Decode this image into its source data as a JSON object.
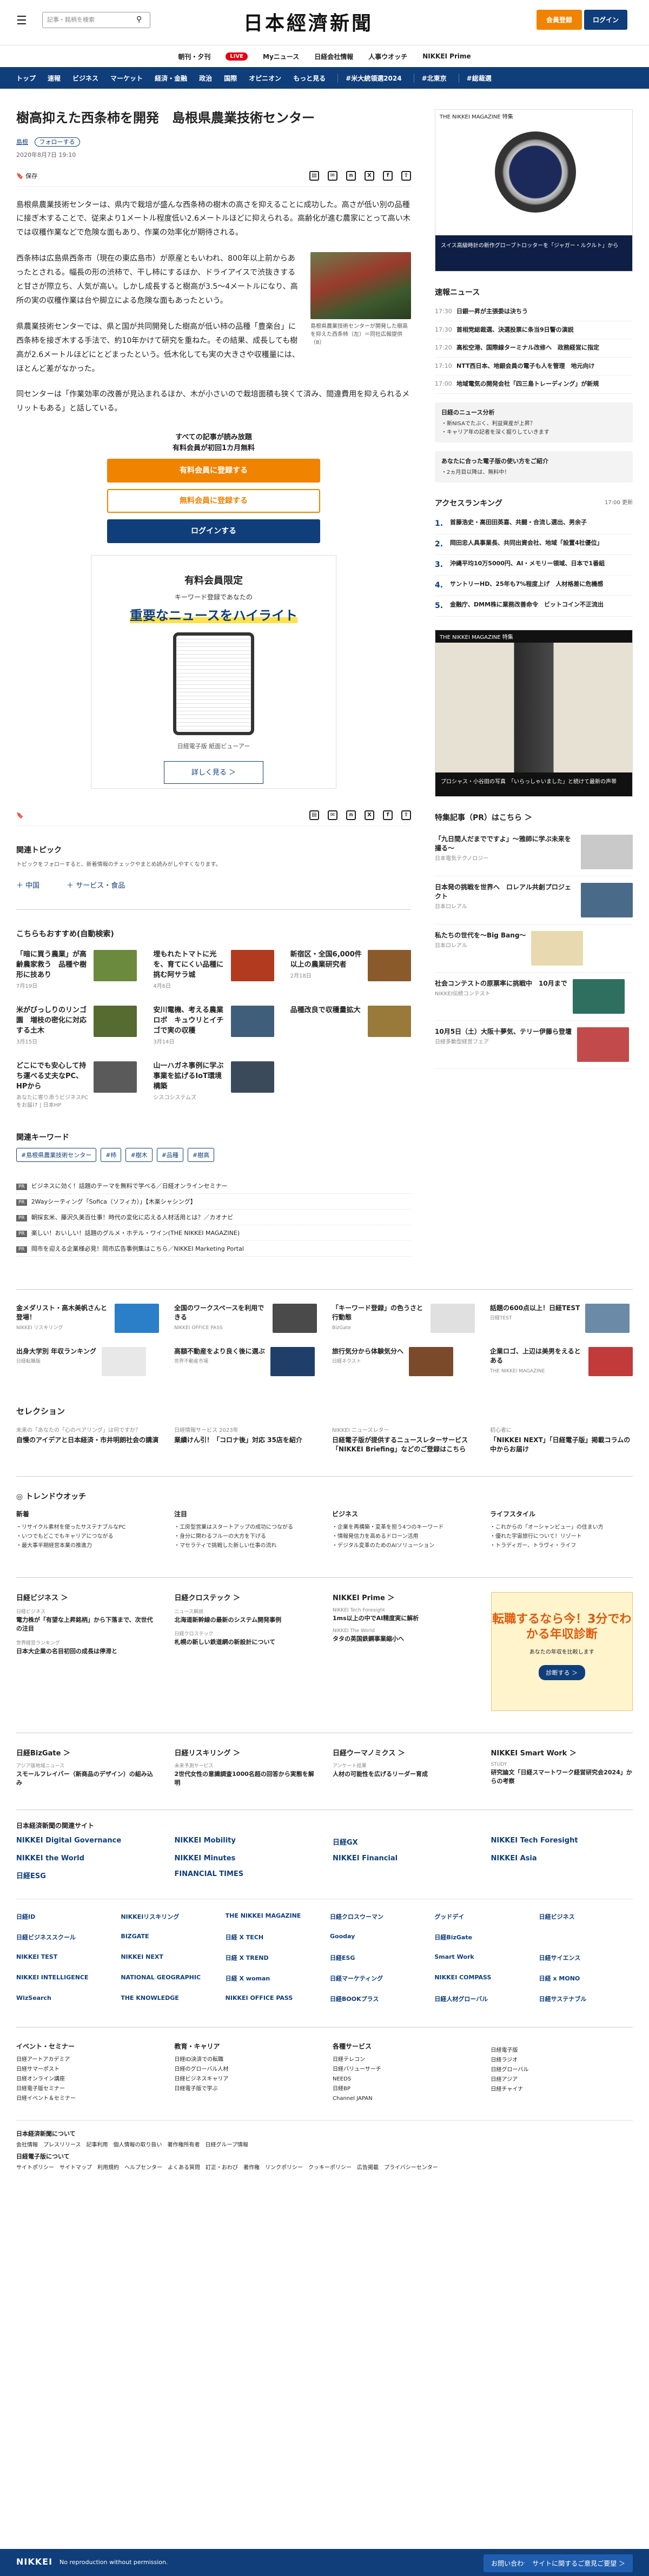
{
  "header": {
    "search_placeholder": "記事・銘柄を検索",
    "logo": "日本經濟新聞",
    "member_button": "会員登録",
    "login_button": "ログイン"
  },
  "subnav": [
    "朝刊・夕刊",
    "LIVE",
    "Myニュース",
    "日経会社情報",
    "人事ウオッチ",
    "NIKKEI Prime"
  ],
  "gnav": [
    "トップ",
    "速報",
    "ビジネス",
    "マーケット",
    "経済・金融",
    "政治",
    "国際",
    "オピニオン",
    "もっと見る",
    "#米大統領選2024",
    "#北東京",
    "#総裁選"
  ],
  "article": {
    "title": "樹高抑えた西条柿を開発　島根県農業技術センター",
    "tag": "島根",
    "follow": "フォローする",
    "date": "2020年8月7日 19:10",
    "save": "保存",
    "p1": "島根県農業技術センターは、県内で栽培が盛んな西条柿の樹木の高さを抑えることに成功した。高さが低い別の品種に接ぎ木することで、従来より1メートル程度低い2.6メートルほどに抑えられる。高齢化が進む農家にとって高い木では収穫作業などで危険な面もあり、作業の効率化が期待される。",
    "p2": "西条柿は広島県西条市（現在の東広島市）が原産ともいわれ、800年以上前からあったとされる。幅長の形の渋柿で、干し柿にするほか、ドライアイスで渋抜きすると甘さが際立ち、人気が高い。しかし成長すると樹高が3.5〜4メートルになり、高所の実の収穫作業は台や脚立による危険な面もあったという。",
    "p3": "県農業技術センターでは、県と国が共同開発した樹高が低い柿の品種「豊楽台」に西条柿を接ぎ木する手法で、約10年かけて研究を重ねた。その結果、成長しても樹高が2.6メートルほどにとどまったという。低木化しても実の大きさや収穫量には、ほとんど差がなかった。",
    "p4": "同センターは「作業効率の改善が見込まれるほか、木が小さいので栽培面積も狭くて済み、間違費用を抑えられるメリットもある」と話している。",
    "figcap": "島根県農業技術センターが開発した樹高を抑えた西条柿（左）＝同社広報提供（8）"
  },
  "paywall": {
    "lead1": "すべての記事が読み放題",
    "lead2": "有料会員が初回1カ月無料",
    "btn_register": "有料会員に登録する",
    "btn_free": "無料会員に登録する",
    "btn_login": "ログインする"
  },
  "promo": {
    "t1": "有料会員限定",
    "t2": "キーワード登録であなたの",
    "t3a": "重要なニュースを",
    "t3b": "ハイライト",
    "cap": "日経電子版 紙面ビューアー",
    "more": "詳しく見る ＞"
  },
  "topics": {
    "heading": "関連トピック",
    "sub": "トピックをフォローすると、新着情報のチェックやまとめ読みがしやすくなります。",
    "items": [
      "＋ 中国",
      "＋ サービス・食品"
    ]
  },
  "reco": {
    "heading": "こちらもおすすめ(自動検索)",
    "items": [
      {
        "title": "「暗に買う農業」が高齢農家救う　品種や樹形に技あり",
        "sub": "7月19日",
        "color": "#6c8a3e"
      },
      {
        "title": "埋もれたトマトに光を、育てにくい品種に挑む阿サラ城",
        "sub": "4月6日",
        "color": "#b23a1e"
      },
      {
        "title": "新宿区・全国6,000件以上の農業研究者",
        "sub": "2月18日",
        "color": "#8a5a2a"
      },
      {
        "title": "米がびっしりのリンゴ園　増枝の密化に対応する土木",
        "sub": "3月15日",
        "color": "#556b2f"
      },
      {
        "title": "安川電機、考える農業ロボ　キュウリとイチゴで実の収穫",
        "sub": "3月14日",
        "color": "#3f5e7a"
      },
      {
        "title": "品種改良で収穫量拡大",
        "sub": "",
        "color": "#9a7a3a"
      },
      {
        "title": "どこにでも安心して持ち運べる丈夫なPC、HPから",
        "sub": "あなたに寄り添うビジネスPCをお届け | 日本HP",
        "color": "#5a5a5a"
      },
      {
        "title": "山一ハガネ事例に学ぶ事業を拡げるIoT環境構築",
        "sub": "シスコシステムズ",
        "color": "#3a4a5a"
      },
      {
        "title": "",
        "sub": "",
        "color": "#ffffff"
      }
    ]
  },
  "keywords": {
    "heading": "関連キーワード",
    "items": [
      "#島根県農業技術センター",
      "#柿",
      "#樹木",
      "#品種",
      "#樹高"
    ]
  },
  "pr_list": [
    "ビジネスに効く！話題のテーマを無料で学べる／日経オンラインセミナー",
    "2Wayシーティング「Sofica（ソフィカ）」【木楽シャシング】",
    "朝採玄米、藤沢久美百仕事！時代の変化に応える人材活用とは？／カオナビ",
    "楽しい！おいしい！話題のグルメ・ホテル・ワイン(THE NIKKEI MAGAZINE)",
    "岡市を迎える企業様必見！岡市広告事例集はこちら／NIKKEI Marketing Portal"
  ],
  "side": {
    "mag_label": "THE NIKKEI MAGAZINE 特集",
    "mag_band": "スイス高級時計の新作グローブトロッターを「ジャガー・ルクルト」から",
    "breaking_heading": "速報ニュース",
    "breaking": [
      {
        "time": "17:30",
        "text": "日銀一昇が主張委は決ちう"
      },
      {
        "time": "17:30",
        "text": "首相党総裁選、決選投票に条当9日警の演説"
      },
      {
        "time": "17:20",
        "text": "高松空港、国際線ターミナル改修へ　政務経営に指定"
      },
      {
        "time": "17:10",
        "text": "NTT西日本、地銀会員の電子も人を管理　地元向け"
      },
      {
        "time": "17:00",
        "text": "地域電気の開発会社「四三島トレーディング」が新規"
      }
    ],
    "nikkei_box_title": "日経のニュース分析",
    "nikkei_box_items": [
      "・新NISAでたぶく、利益資産が上昇？",
      "・キャリア年の記者を深く掘りしていきます"
    ],
    "nikkei_box2_title": "あなたに合った電子版の使い方をご紹介",
    "nikkei_box2_items": [
      "・2ヵ月目以降は、無料中！"
    ],
    "ranking_heading": "アクセスランキング",
    "ranking_time": "17:00 更新",
    "ranking": [
      "首藤浩史・高田田英喜、共闘・合流し選出、男余子",
      "岡田忠人具事業長、共同出資会社、地域「設置4社優位」",
      "沖縄平均10万5000円、AI・メモリー領域、日本で1番組",
      "サントリーHD、25年も7%程度上げ　人材格差に危機感",
      "金融庁、DMM株に業務改善命令　ビットコイン不正流出"
    ],
    "photo_label": "THE NIKKEI MAGAZINE 特集",
    "photo_band": "プロシャス・小谷田の写真　「いらっしゃいました」と続けて最新の声帯",
    "pr_heading": "特集記事（PR）はこちら ＞",
    "pr_items": [
      {
        "title": "「九日間人だまでですよ」〜雅師に学ぶ未来を撮る〜",
        "sub": "日本電気テクノロジー",
        "color": "#c9c9c9"
      },
      {
        "title": "日本発の挑戦を世界へ　ロレアル共創プロジェクト",
        "sub": "日本ロレアル",
        "color": "#4a6a8a"
      },
      {
        "title": "私たちの世代を〜Big Bang〜",
        "sub": "日本ロレアル",
        "color": "#e8d9b0"
      },
      {
        "title": "社会コンテストの原票率に挑戦中　10月まで",
        "sub": "NIKKEI伝統コンテスト",
        "color": "#2f6f5f"
      },
      {
        "title": "10月5日（土）大阪十夢気、テリー伊藤ら登壇",
        "sub": "日経多動型経営フェア",
        "color": "#c24a4a"
      }
    ]
  },
  "ads": [
    {
      "title": "金メダリスト・高木美帆さんと登場！",
      "sub": "NIKKEI リスキリング",
      "color": "#2b7fc8"
    },
    {
      "title": "全国のワークスペースを利用できる",
      "sub": "NIKKEI OFFICE PASS",
      "color": "#4a4a4a"
    },
    {
      "title": "「キーワード登録」の色うさと行動態",
      "sub": "BizGate",
      "color": "#e0e0e0"
    },
    {
      "title": "話題の600点以上！日経TEST",
      "sub": "日経TEST",
      "color": "#6a8aa8"
    },
    {
      "title": "出身大学別 年収ランキング",
      "sub": "日経転職版",
      "color": "#e8e8e8"
    },
    {
      "title": "高額不動産をより良く後に選ぶ",
      "sub": "世界不動産市場",
      "color": "#1f3f6a"
    },
    {
      "title": "旅行気分から体験気分へ",
      "sub": "日経ネクスト",
      "color": "#7a4a2a"
    },
    {
      "title": "企業ロゴ、上辺は美男をえるとある",
      "sub": "THE NIKKEI MAGAZINE",
      "color": "#c23a3a"
    }
  ],
  "selection": {
    "heading": "セレクション",
    "items": [
      {
        "k": "未来の「あなたの「心のペアリング」は何ですか？",
        "v": "自慢のアイデアと日本経済・市井明朗社会の講演"
      },
      {
        "k": "日経情報サービス 2023年",
        "v": "業績けん引！「コロナ後」対応 35店を紹介"
      },
      {
        "k": "NIKKEI ニュースレター",
        "v": "日経電子版が提供するニュースレターサービス「NIKKEI Briefing」などのご登録はこちら"
      },
      {
        "k": "初心者に",
        "v": "「NIKKEI NEXT」「日経電子版」掲載コラムの中からお届け"
      }
    ]
  },
  "trend": {
    "heading": "トレンドウオッチ",
    "cols": [
      {
        "k": "新着",
        "items": [
          "・リサイクル素材を使ったサステナブルなPC",
          "・いつでもどこでもキャリアにつながる",
          "・最大事半期経営本業の推進力"
        ]
      },
      {
        "k": "注目",
        "items": [
          "・工房型営業はスタートアップの成功につながる",
          "・身分に関わるフルーの大方を下げる",
          "・マセラティで挑戦した新しい仕事の流れ"
        ]
      },
      {
        "k": "ビジネス",
        "items": [
          "・企業を再構築・変革を担う4つのキーワード",
          "・情報発信力を高めるドローン活用",
          "・デジタル変革のためのAIソリューション"
        ]
      },
      {
        "k": "ライフスタイル",
        "items": [
          "・これからの「オーシャンビュー」の住まい方",
          "・優れた宇宙旅行について！リゾート",
          "・トラディガー、トラヴィ・ライフ"
        ]
      }
    ]
  },
  "services": [
    {
      "k": "日経ビジネス ＞",
      "items": [
        {
          "s": "日経ビジネス",
          "v": "電力株が「有望な上昇銘柄」から下落まで、次世代の注目"
        },
        {
          "s": "世界経営ランキング",
          "v": "日本大企業の名目初回の成長は停滞と"
        }
      ]
    },
    {
      "k": "日経クロステック ＞",
      "items": [
        {
          "s": "ニュース解説",
          "v": "北海道新幹線の最新のシステム開発事例"
        },
        {
          "s": "日経クロステック",
          "v": "札幌の新しい鉄道網の新設計について"
        }
      ]
    },
    {
      "k": "NIKKEI Prime ＞",
      "items": [
        {
          "s": "NIKKEI Tech Foresight",
          "v": "1ms以上の中でAI精度実に解析"
        },
        {
          "s": "NIKKEI The World",
          "v": "タタの英国鉄鋼事業縮小へ"
        }
      ]
    }
  ],
  "ad_box": {
    "big": "転職するなら今！3分でわかる年収診断",
    "mid": "あなたの年収を比較します",
    "btn": "診断する ＞"
  },
  "lower": [
    {
      "k": "日経BizGate ＞",
      "items": [
        {
          "s": "アジア版地域ニュース",
          "v": "スモールフレイバー（新商品のデザイン）の組み込み"
        }
      ]
    },
    {
      "k": "日経リスキリング ＞",
      "items": [
        {
          "s": "未来予測サービス",
          "v": "2世代女性の意識調査1000名超の回答から実態を解明"
        }
      ]
    },
    {
      "k": "日経ウーマノミクス ＞",
      "items": [
        {
          "s": "アンケート結果",
          "v": "人材の可能性を広げるリーダー育成"
        }
      ]
    },
    {
      "k": "NIKKEI Smart Work ＞",
      "items": [
        {
          "s": "STUDY",
          "v": "研究論文「日経スマートワーク経営研究会2024」からの考察"
        }
      ]
    }
  ],
  "related": {
    "heading": "日本経済新聞の関連サイト",
    "items": [
      "NIKKEI Digital Governance",
      "NIKKEI Mobility",
      "日経GX",
      "NIKKEI Tech Foresight",
      "NIKKEI the World",
      "NIKKEI Minutes",
      "NIKKEI Financial",
      "NIKKEI Asia",
      "日経ESG",
      "FINANCIAL TIMES",
      "",
      ""
    ]
  },
  "logos": [
    "日経ID",
    "NIKKEIリスキリング",
    "THE NIKKEI MAGAZINE",
    "日経クロスウーマン",
    "グッドデイ",
    "日経ビジネス",
    "日経ビジネススクール",
    "BIZGATE",
    "日経 X TECH",
    "Gooday",
    "日経BizGate",
    "",
    "NIKKEI TEST",
    "NIKKEI NEXT",
    "日経 X TREND",
    "日経ESG",
    "Smart Work",
    "日経サイエンス",
    "NIKKEI INTELLIGENCE",
    "NATIONAL GEOGRAPHIC",
    "日経 X woman",
    "日経マーケティング",
    "NIKKEI COMPASS",
    "日経 x MONO",
    "WizSearch",
    "THE KNOWLEDGE",
    "NIKKEI OFFICE PASS",
    "日経BOOKプラス",
    "日経人材グローバル",
    "日経サステナブル"
  ],
  "footer": {
    "cols": [
      {
        "k": "イベント・セミナー",
        "items": [
          "日経アートアカデミア",
          "日経サマーポスト",
          "日経オンライン講座",
          "日経電子版セミナー",
          "日経イベント＆セミナー"
        ]
      },
      {
        "k": "教育・キャリア",
        "items": [
          "日経ID決済での転職",
          "日経のグローバル人材",
          "日経ビジネスキャリア",
          "日経電子版で学ぶ"
        ]
      },
      {
        "k": "各種サービス",
        "items": [
          "日経テレコン",
          "日経バリューサーチ",
          "NEEDS",
          "日経BP",
          "Channel JAPAN"
        ]
      },
      {
        "k": "",
        "items": [
          "日経電子版",
          "日経ラジオ",
          "日経グローバル",
          "日経アジア",
          "日経チャイナ"
        ]
      }
    ],
    "link_groups": [
      {
        "k": "日本経済新聞について",
        "v": "会社情報　プレスリリース　記事利用　個人情報の取り扱い　著作権所有者　日経グループ情報"
      },
      {
        "k": "日経電子版について",
        "v": "サイトポリシー　サイトマップ　利用規約　ヘルプセンター　よくある質問　訂正・おわび　著作権　リンクポリシー　クッキーポリシー　広告掲載　プライバシーセンター"
      }
    ]
  },
  "bottom_bar": {
    "logo": "NIKKEI",
    "nrp": "No reproduction without permission.",
    "b1": "お問い合わせ ＞",
    "b2": "サイトに関するご意見ご要望 ＞"
  }
}
